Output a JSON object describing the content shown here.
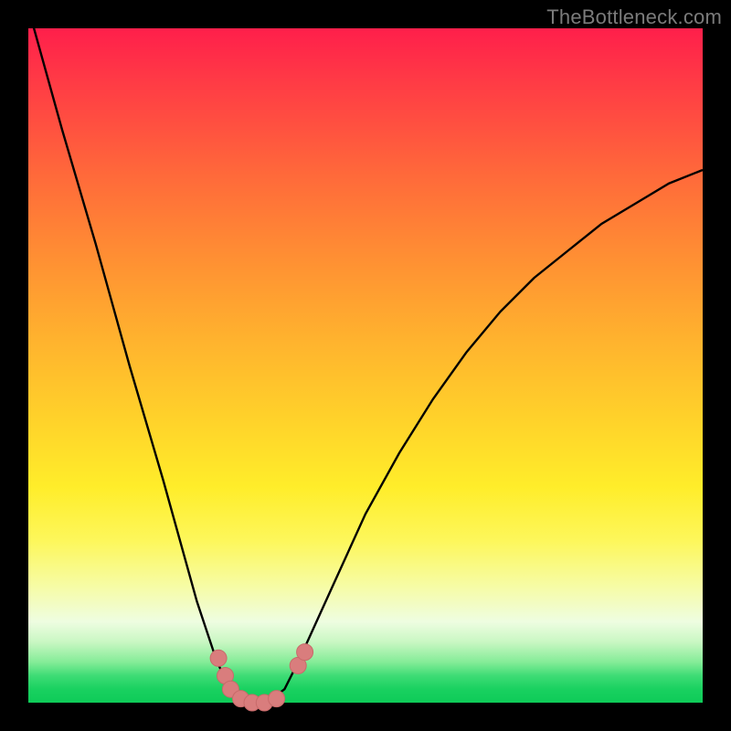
{
  "watermark": "TheBottleneck.com",
  "colors": {
    "frame": "#000000",
    "curve_stroke": "#000000",
    "marker_fill": "#d97d7d",
    "marker_stroke": "#c86a6a",
    "gradient_top": "#ff1f4b",
    "gradient_mid": "#ffed2a",
    "gradient_bottom": "#0ecb58",
    "watermark_text": "#7b7b7b"
  },
  "chart_data": {
    "type": "line",
    "title": "",
    "xlabel": "",
    "ylabel": "",
    "x": [
      0.0,
      0.05,
      0.1,
      0.15,
      0.2,
      0.25,
      0.28,
      0.3,
      0.32,
      0.34,
      0.36,
      0.38,
      0.4,
      0.45,
      0.5,
      0.55,
      0.6,
      0.65,
      0.7,
      0.75,
      0.8,
      0.85,
      0.9,
      0.95,
      1.0
    ],
    "y": [
      1.03,
      0.85,
      0.68,
      0.5,
      0.33,
      0.15,
      0.06,
      0.02,
      0.005,
      0.0,
      0.005,
      0.02,
      0.06,
      0.17,
      0.28,
      0.37,
      0.45,
      0.52,
      0.58,
      0.63,
      0.67,
      0.71,
      0.74,
      0.77,
      0.79
    ],
    "xlim": [
      0,
      1
    ],
    "ylim": [
      0,
      1
    ],
    "markers": [
      {
        "x": 0.282,
        "y": 0.066
      },
      {
        "x": 0.292,
        "y": 0.04
      },
      {
        "x": 0.3,
        "y": 0.02
      },
      {
        "x": 0.315,
        "y": 0.006
      },
      {
        "x": 0.332,
        "y": 0.0
      },
      {
        "x": 0.35,
        "y": 0.0
      },
      {
        "x": 0.368,
        "y": 0.006
      },
      {
        "x": 0.4,
        "y": 0.055
      },
      {
        "x": 0.41,
        "y": 0.075
      }
    ],
    "gradient_meaning": "background hue encodes value from red (high) at top to green (low) at bottom"
  }
}
